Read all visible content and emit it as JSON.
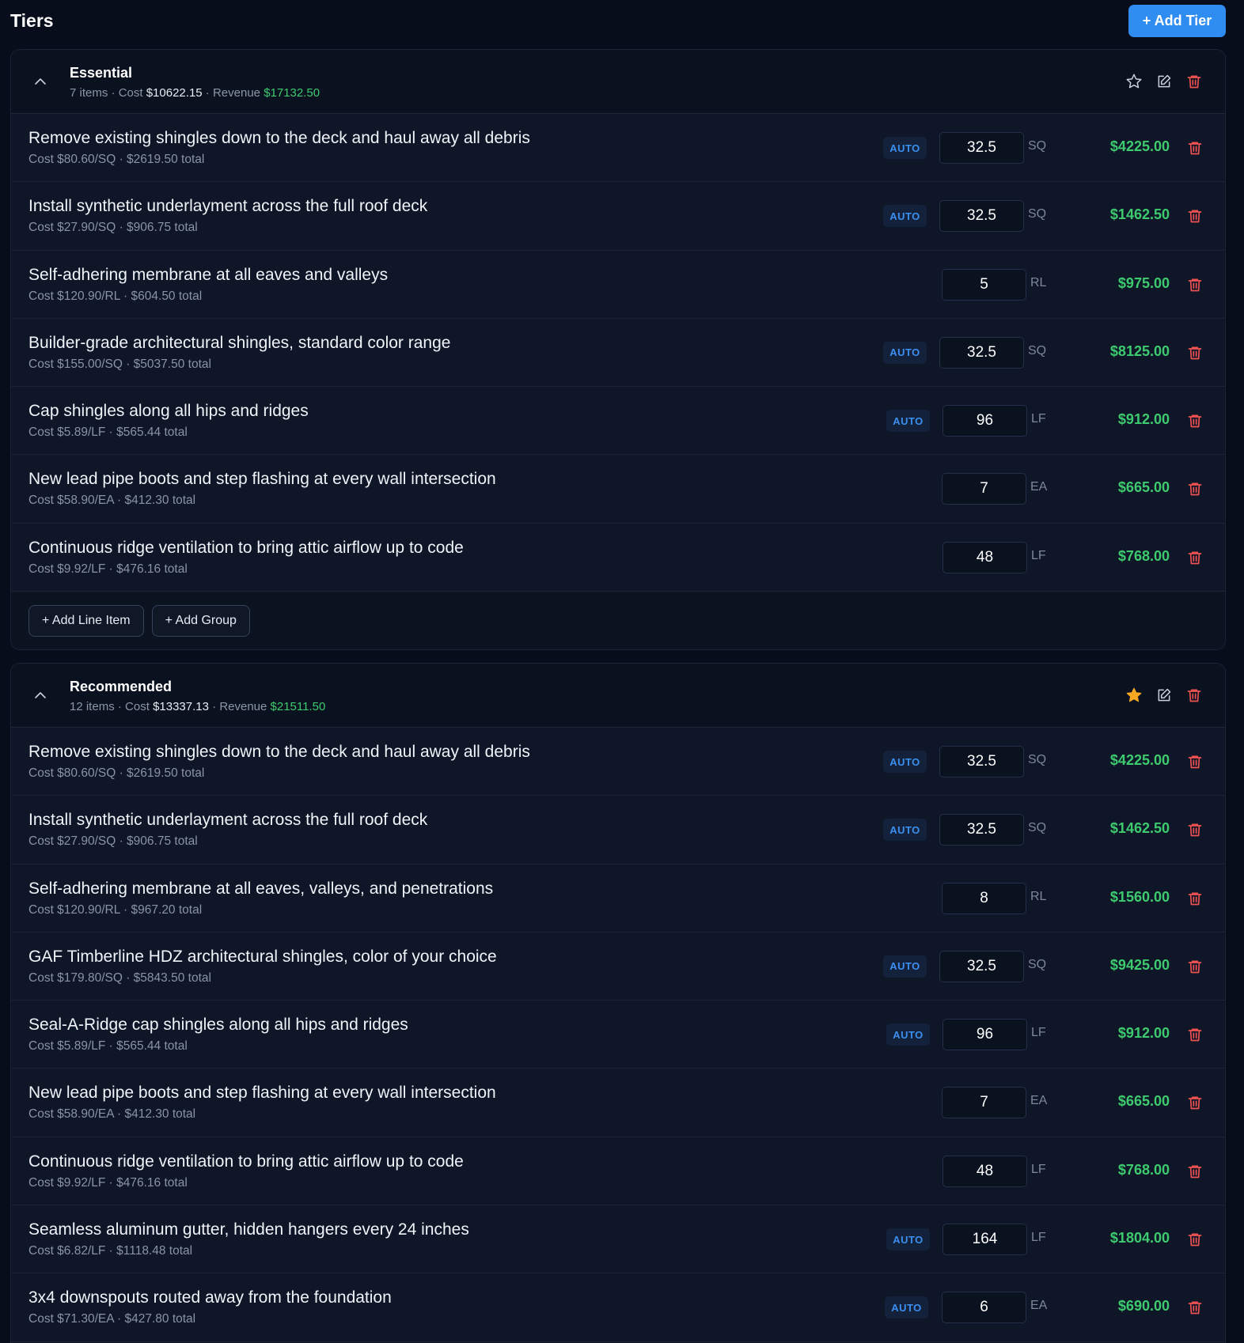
{
  "page": {
    "title": "Tiers",
    "add_tier_label": "+ Add Tier"
  },
  "colors": {
    "revenue": "#3ecb6f",
    "accent": "#2f8cf0",
    "delete": "#f05252",
    "star_active": "#f5a623"
  },
  "tiers": [
    {
      "name": "Essential",
      "items_text": "7 items",
      "cost_label": "Cost",
      "cost": "$10622.15",
      "revenue_label": "Revenue",
      "revenue": "$17132.50",
      "starred": false,
      "add_line_item_label": "+ Add Line Item",
      "add_group_label": "+ Add Group",
      "rows": [
        {
          "title": "Remove existing shingles down to the deck and haul away all debris",
          "subtitle": "Cost $80.60/SQ · $2619.50 total",
          "auto": true,
          "auto_label": "AUTO",
          "qty": "32.5",
          "unit": "SQ",
          "price": "$4225.00"
        },
        {
          "title": "Install synthetic underlayment across the full roof deck",
          "subtitle": "Cost $27.90/SQ · $906.75 total",
          "auto": true,
          "auto_label": "AUTO",
          "qty": "32.5",
          "unit": "SQ",
          "price": "$1462.50"
        },
        {
          "title": "Self-adhering membrane at all eaves and valleys",
          "subtitle": "Cost $120.90/RL · $604.50 total",
          "auto": false,
          "auto_label": "",
          "qty": "5",
          "unit": "RL",
          "price": "$975.00"
        },
        {
          "title": "Builder-grade architectural shingles, standard color range",
          "subtitle": "Cost $155.00/SQ · $5037.50 total",
          "auto": true,
          "auto_label": "AUTO",
          "qty": "32.5",
          "unit": "SQ",
          "price": "$8125.00"
        },
        {
          "title": "Cap shingles along all hips and ridges",
          "subtitle": "Cost $5.89/LF · $565.44 total",
          "auto": true,
          "auto_label": "AUTO",
          "qty": "96",
          "unit": "LF",
          "price": "$912.00"
        },
        {
          "title": "New lead pipe boots and step flashing at every wall intersection",
          "subtitle": "Cost $58.90/EA · $412.30 total",
          "auto": false,
          "auto_label": "",
          "qty": "7",
          "unit": "EA",
          "price": "$665.00"
        },
        {
          "title": "Continuous ridge ventilation to bring attic airflow up to code",
          "subtitle": "Cost $9.92/LF · $476.16 total",
          "auto": false,
          "auto_label": "",
          "qty": "48",
          "unit": "LF",
          "price": "$768.00"
        }
      ]
    },
    {
      "name": "Recommended",
      "items_text": "12 items",
      "cost_label": "Cost",
      "cost": "$13337.13",
      "revenue_label": "Revenue",
      "revenue": "$21511.50",
      "starred": true,
      "rows": [
        {
          "title": "Remove existing shingles down to the deck and haul away all debris",
          "subtitle": "Cost $80.60/SQ · $2619.50 total",
          "auto": true,
          "auto_label": "AUTO",
          "qty": "32.5",
          "unit": "SQ",
          "price": "$4225.00"
        },
        {
          "title": "Install synthetic underlayment across the full roof deck",
          "subtitle": "Cost $27.90/SQ · $906.75 total",
          "auto": true,
          "auto_label": "AUTO",
          "qty": "32.5",
          "unit": "SQ",
          "price": "$1462.50"
        },
        {
          "title": "Self-adhering membrane at all eaves, valleys, and penetrations",
          "subtitle": "Cost $120.90/RL · $967.20 total",
          "auto": false,
          "auto_label": "",
          "qty": "8",
          "unit": "RL",
          "price": "$1560.00"
        },
        {
          "title": "GAF Timberline HDZ architectural shingles, color of your choice",
          "subtitle": "Cost $179.80/SQ · $5843.50 total",
          "auto": true,
          "auto_label": "AUTO",
          "qty": "32.5",
          "unit": "SQ",
          "price": "$9425.00"
        },
        {
          "title": "Seal-A-Ridge cap shingles along all hips and ridges",
          "subtitle": "Cost $5.89/LF · $565.44 total",
          "auto": true,
          "auto_label": "AUTO",
          "qty": "96",
          "unit": "LF",
          "price": "$912.00"
        },
        {
          "title": "New lead pipe boots and step flashing at every wall intersection",
          "subtitle": "Cost $58.90/EA · $412.30 total",
          "auto": false,
          "auto_label": "",
          "qty": "7",
          "unit": "EA",
          "price": "$665.00"
        },
        {
          "title": "Continuous ridge ventilation to bring attic airflow up to code",
          "subtitle": "Cost $9.92/LF · $476.16 total",
          "auto": false,
          "auto_label": "",
          "qty": "48",
          "unit": "LF",
          "price": "$768.00"
        },
        {
          "title": "Seamless aluminum gutter, hidden hangers every 24 inches",
          "subtitle": "Cost $6.82/LF · $1118.48 total",
          "auto": true,
          "auto_label": "AUTO",
          "qty": "164",
          "unit": "LF",
          "price": "$1804.00"
        },
        {
          "title": "3x4 downspouts routed away from the foundation",
          "subtitle": "Cost $71.30/EA · $427.80 total",
          "auto": true,
          "auto_label": "AUTO",
          "qty": "6",
          "unit": "EA",
          "price": "$690.00"
        }
      ]
    }
  ]
}
